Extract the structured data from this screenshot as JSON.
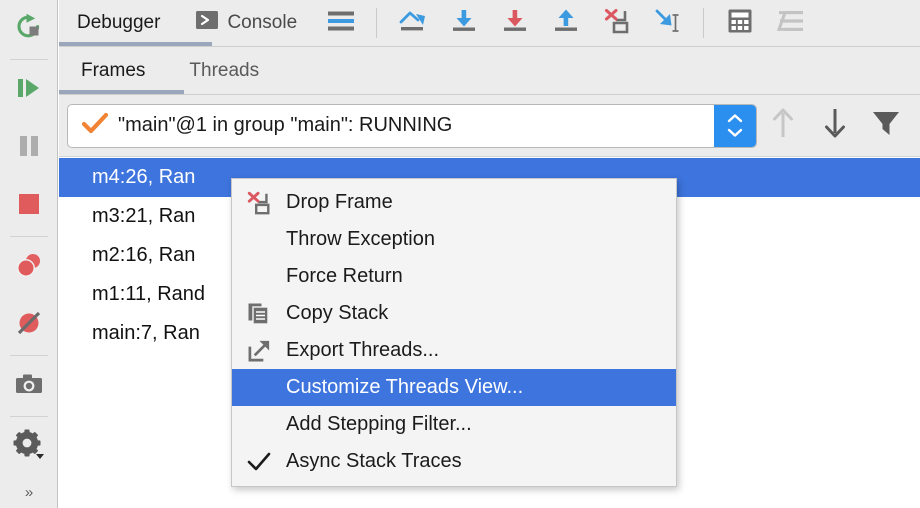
{
  "sidebar": {
    "buttons": [
      {
        "name": "rerun-button",
        "icon": "rerun-icon",
        "tooltip": "Rerun"
      },
      {
        "name": "resume-program-button",
        "icon": "resume-icon",
        "tooltip": "Resume Program"
      },
      {
        "name": "pause-program-button",
        "icon": "pause-icon",
        "tooltip": "Pause Program"
      },
      {
        "name": "stop-button",
        "icon": "stop-icon",
        "tooltip": "Stop"
      },
      {
        "name": "view-breakpoints-button",
        "icon": "breakpoints-icon",
        "tooltip": "View Breakpoints"
      },
      {
        "name": "mute-breakpoints-button",
        "icon": "mute-breakpoints-icon",
        "tooltip": "Mute Breakpoints"
      },
      {
        "name": "get-thread-dump-button",
        "icon": "camera-icon",
        "tooltip": "Get Thread Dump"
      },
      {
        "name": "settings-button",
        "icon": "gear-icon",
        "tooltip": "Settings"
      }
    ],
    "more_label": "»"
  },
  "tabs": {
    "items": [
      {
        "label": "Debugger",
        "icon": null,
        "active": true
      },
      {
        "label": "Console",
        "icon": "console-icon",
        "active": false
      }
    ],
    "underline_width": 153,
    "underline_color": "#9aa7bb"
  },
  "toolbar": {
    "buttons": [
      {
        "name": "layout-settings-button",
        "icon": "layout-icon"
      },
      {
        "name": "show-execution-point-button",
        "icon": "execution-point-icon"
      },
      {
        "name": "step-over-button",
        "icon": "step-over-icon"
      },
      {
        "name": "step-into-button",
        "icon": "step-into-icon"
      },
      {
        "name": "step-out-button",
        "icon": "step-out-icon"
      },
      {
        "name": "drop-frame-button",
        "icon": "drop-frame-icon"
      },
      {
        "name": "run-to-cursor-button",
        "icon": "run-to-cursor-icon"
      },
      {
        "name": "evaluate-expression-button",
        "icon": "calculator-icon"
      },
      {
        "name": "threads-view-button",
        "icon": "threads-list-icon"
      }
    ]
  },
  "subtabs": {
    "items": [
      {
        "label": "Frames",
        "active": true
      },
      {
        "label": "Threads",
        "active": false
      }
    ],
    "underline_width": 125
  },
  "thread_selector": {
    "value": "\"main\"@1 in group \"main\": RUNNING",
    "check_icon": "checkmark-icon",
    "check_color": "#f08334",
    "spinner_color": "#2b8fef",
    "nav_buttons": [
      {
        "name": "previous-frame-button",
        "icon": "arrow-up-icon",
        "enabled": false
      },
      {
        "name": "next-frame-button",
        "icon": "arrow-down-icon",
        "enabled": true
      },
      {
        "name": "filter-button",
        "icon": "funnel-icon",
        "enabled": true
      }
    ]
  },
  "frames": {
    "selection_color": "#3d74dd",
    "rows": [
      {
        "label": "m4:26, Ran",
        "selected": true
      },
      {
        "label": "m3:21, Ran",
        "selected": false
      },
      {
        "label": "m2:16, Ran",
        "selected": false
      },
      {
        "label": "m1:11, Rand",
        "selected": false
      },
      {
        "label": "main:7, Ran",
        "selected": false
      }
    ]
  },
  "context_menu": {
    "highlight_color": "#3d74dd",
    "items": [
      {
        "label": "Drop Frame",
        "icon": "drop-frame-icon",
        "highlight": false
      },
      {
        "label": "Throw Exception",
        "icon": null,
        "highlight": false
      },
      {
        "label": "Force Return",
        "icon": null,
        "highlight": false
      },
      {
        "label": "Copy Stack",
        "icon": "copy-icon",
        "highlight": false
      },
      {
        "label": "Export Threads...",
        "icon": "export-icon",
        "highlight": false
      },
      {
        "label": "Customize Threads View...",
        "icon": null,
        "highlight": true
      },
      {
        "label": "Add Stepping Filter...",
        "icon": null,
        "highlight": false
      },
      {
        "label": "Async Stack Traces",
        "icon": "checkmark-icon",
        "highlight": false
      }
    ]
  }
}
